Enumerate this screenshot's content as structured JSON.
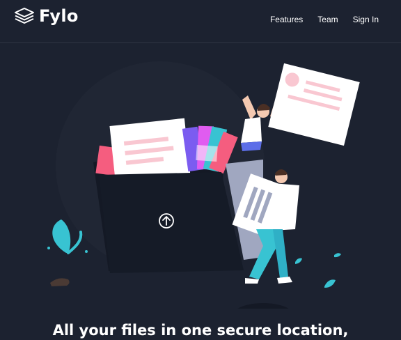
{
  "header": {
    "brand": "Fylo",
    "logo_icon": "stacked-layers-icon",
    "nav": [
      {
        "label": "Features"
      },
      {
        "label": "Team"
      },
      {
        "label": "Sign In"
      }
    ]
  },
  "hero": {
    "headline": "All your files in one secure location,",
    "illustration_icon": "upload-arrow-icon"
  },
  "colors": {
    "background": "#1c2230",
    "folder": "#141925",
    "accent_pink": "#f55d7f",
    "accent_teal": "#38c3d2",
    "text": "#ffffff"
  }
}
